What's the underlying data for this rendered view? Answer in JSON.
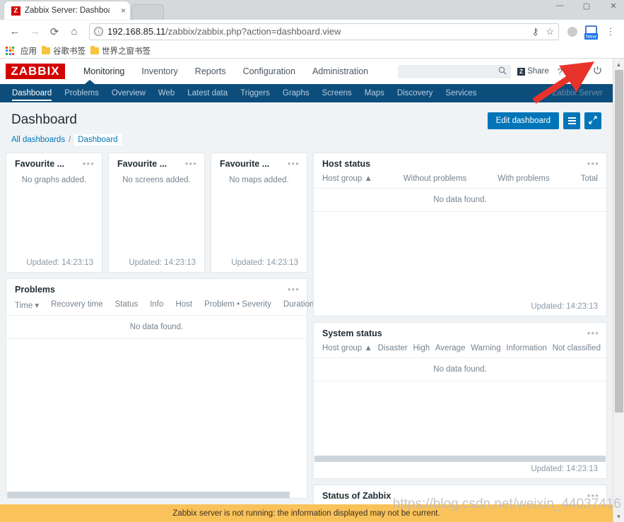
{
  "browser": {
    "tab": {
      "title": "Zabbix Server: Dashboa",
      "favicon_letter": "Z",
      "close_icon": "×"
    },
    "window_controls": {
      "minimize": "—",
      "maximize": "▢",
      "close": "✕"
    },
    "nav": {
      "back_icon": "←",
      "forward_icon": "→",
      "reload_icon": "⟳",
      "home_icon": "⌂",
      "info_icon": "ⓘ",
      "url_host": "192.168.85.11",
      "url_path": "/zabbix/zabbix.php?action=dashboard.view",
      "key_icon": "⚷",
      "star_icon": "☆",
      "new_badge_label": "New",
      "menu_icon": "⋮"
    },
    "bookmarks": {
      "apps_label": "应用",
      "items": [
        {
          "label": "谷歌书签"
        },
        {
          "label": "世界之窗书签"
        }
      ]
    }
  },
  "zabbix": {
    "logo": "ZABBIX",
    "topmenu": [
      {
        "label": "Monitoring",
        "selected": true
      },
      {
        "label": "Inventory",
        "selected": false
      },
      {
        "label": "Reports",
        "selected": false
      },
      {
        "label": "Configuration",
        "selected": false
      },
      {
        "label": "Administration",
        "selected": false
      }
    ],
    "search": {
      "placeholder": "",
      "value": "",
      "icon": "search-icon"
    },
    "share_label": "Share",
    "help_icon": "?",
    "user_icon": "user-icon",
    "power_icon": "⏻",
    "submenu": [
      {
        "label": "Dashboard",
        "selected": true
      },
      {
        "label": "Problems",
        "selected": false
      },
      {
        "label": "Overview",
        "selected": false
      },
      {
        "label": "Web",
        "selected": false
      },
      {
        "label": "Latest data",
        "selected": false
      },
      {
        "label": "Triggers",
        "selected": false
      },
      {
        "label": "Graphs",
        "selected": false
      },
      {
        "label": "Screens",
        "selected": false
      },
      {
        "label": "Maps",
        "selected": false
      },
      {
        "label": "Discovery",
        "selected": false
      },
      {
        "label": "Services",
        "selected": false
      }
    ],
    "server_label": "Zabbix Server",
    "page_title": "Dashboard",
    "edit_dashboard_label": "Edit dashboard",
    "breadcrumb": {
      "all_dashboards": "All dashboards",
      "separator": "/",
      "current": "Dashboard"
    },
    "widgets": {
      "fav_graphs": {
        "title": "Favourite ...",
        "empty": "No graphs added.",
        "updated": "Updated: 14:23:13",
        "menu_icon": "•••"
      },
      "fav_screens": {
        "title": "Favourite ...",
        "empty": "No screens added.",
        "updated": "Updated: 14:23:13",
        "menu_icon": "•••"
      },
      "fav_maps": {
        "title": "Favourite ...",
        "empty": "No maps added.",
        "updated": "Updated: 14:23:13",
        "menu_icon": "•••"
      },
      "problems": {
        "title": "Problems",
        "columns": [
          "Time ▾",
          "Recovery time",
          "Status",
          "Info",
          "Host",
          "Problem • Severity",
          "Duration"
        ],
        "no_data": "No data found.",
        "menu_icon": "•••"
      },
      "host_status": {
        "title": "Host status",
        "columns": [
          "Host group ▲",
          "Without problems",
          "With problems",
          "Total"
        ],
        "no_data": "No data found.",
        "updated": "Updated: 14:23:13",
        "menu_icon": "•••"
      },
      "system_status": {
        "title": "System status",
        "columns": [
          "Host group ▲",
          "Disaster",
          "High",
          "Average",
          "Warning",
          "Information",
          "Not classified"
        ],
        "no_data": "No data found.",
        "updated": "Updated: 14:23:13",
        "menu_icon": "•••"
      },
      "status_of_zabbix": {
        "title": "Status of Zabbix",
        "menu_icon": "•••"
      }
    },
    "warning_message": "Zabbix server is not running: the information displayed may not be current."
  },
  "overlay": {
    "watermark": "https://blog.csdn.net/weixin_44037416",
    "arrow_color": "#e8332a"
  },
  "colors": {
    "zabbix_red": "#d40000",
    "nav_blue": "#0d4d7c",
    "accent_blue": "#0275b8",
    "warning_yellow": "#fac25a",
    "page_bg": "#f0f3f5"
  }
}
